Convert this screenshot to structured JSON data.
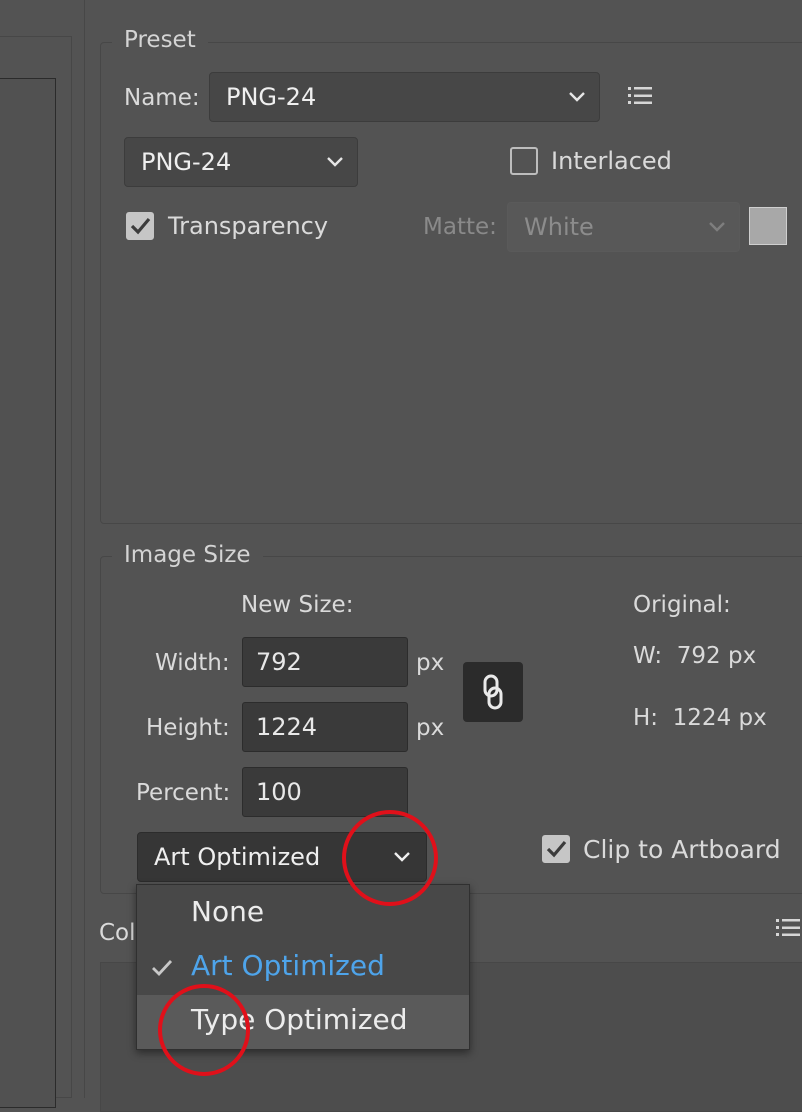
{
  "preset": {
    "legend": "Preset",
    "name_label": "Name:",
    "name_value": "PNG-24",
    "format_value": "PNG-24",
    "interlaced_label": "Interlaced",
    "interlaced_checked": false,
    "transparency_label": "Transparency",
    "transparency_checked": true,
    "matte_label": "Matte:",
    "matte_value": "White",
    "matte_swatch_color": "#a8a8a8"
  },
  "image_size": {
    "legend": "Image Size",
    "new_size_label": "New Size:",
    "width_label": "Width:",
    "width_value": "792",
    "height_label": "Height:",
    "height_value": "1224",
    "percent_label": "Percent:",
    "percent_value": "100",
    "unit_px": "px",
    "original_label": "Original:",
    "orig_w": "W:  792 px",
    "orig_h": "H:  1224 px",
    "resample_value": "Art Optimized",
    "clip_label": "Clip to Artboard",
    "clip_checked": true
  },
  "color_table": {
    "legend_partial": "Col"
  },
  "dropdown_menu": {
    "options": [
      {
        "label": "None",
        "selected": false,
        "hover": false
      },
      {
        "label": "Art Optimized",
        "selected": true,
        "hover": false
      },
      {
        "label": "Type Optimized",
        "selected": false,
        "hover": true
      }
    ]
  },
  "colors": {
    "highlight_circle": "#e0101a",
    "selected_item": "#4ea4ea"
  }
}
